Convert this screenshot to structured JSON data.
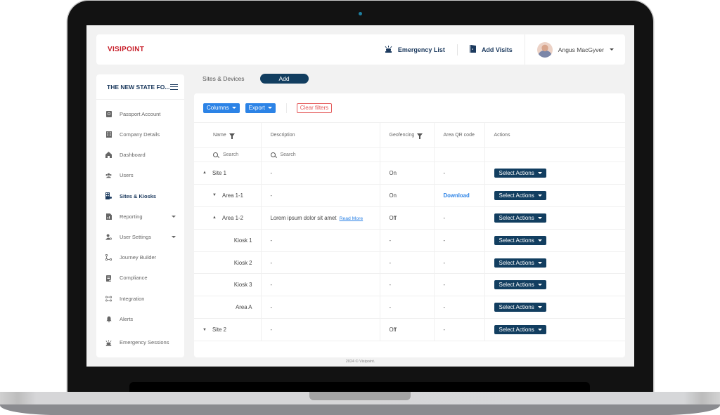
{
  "brand": {
    "logo": "VISIPOINT",
    "accent": "#c8202b",
    "primary": "#123e60",
    "link": "#2c83e6"
  },
  "header": {
    "emergency_list": "Emergency List",
    "add_visits": "Add Visits",
    "user_name": "Angus MacGyver"
  },
  "sidebar": {
    "org_name": "THE NEW STATE FO...",
    "items": [
      {
        "label": "Passport Account",
        "icon": "passport-icon"
      },
      {
        "label": "Company Details",
        "icon": "building-icon"
      },
      {
        "label": "Dashboard",
        "icon": "home-icon"
      },
      {
        "label": "Users",
        "icon": "users-icon"
      },
      {
        "label": "Sites & Kiosks",
        "icon": "sites-icon",
        "active": true
      },
      {
        "label": "Reporting",
        "icon": "report-icon",
        "expandable": true
      },
      {
        "label": "User Settings",
        "icon": "user-settings-icon",
        "expandable": true
      },
      {
        "label": "Journey Builder",
        "icon": "journey-icon"
      },
      {
        "label": "Compliance",
        "icon": "compliance-icon"
      },
      {
        "label": "Integration",
        "icon": "integration-icon"
      },
      {
        "label": "Alerts",
        "icon": "bell-icon"
      },
      {
        "label": "Emergency Sessions",
        "icon": "siren-icon"
      }
    ]
  },
  "content": {
    "breadcrumb": "Sites & Devices",
    "add_label": "Add",
    "toolbar": {
      "columns": "Columns",
      "export": "Export",
      "clear_filters": "Clear filters"
    },
    "table": {
      "columns": [
        "Name",
        "Description",
        "Geofencing",
        "Area QR code",
        "Actions"
      ],
      "search_placeholder": "Search",
      "rows": [
        {
          "name": "Site 1",
          "level": 0,
          "toggle": "up",
          "description": "-",
          "geofencing": "On",
          "qr": "-",
          "action": "Select Actions"
        },
        {
          "name": "Area 1-1",
          "level": 1,
          "toggle": "down",
          "description": "-",
          "geofencing": "On",
          "qr": "Download",
          "action": "Select Actions"
        },
        {
          "name": "Area 1-2",
          "level": 1,
          "toggle": "up",
          "description": "Lorem ipsum dolor sit amet",
          "read_more": "Read More",
          "geofencing": "Off",
          "qr": "-",
          "action": "Select Actions"
        },
        {
          "name": "Kiosk 1",
          "level": 2,
          "description": "-",
          "geofencing": "-",
          "qr": "-",
          "action": "Select Actions"
        },
        {
          "name": "Kiosk 2",
          "level": 2,
          "description": "-",
          "geofencing": "-",
          "qr": "-",
          "action": "Select Actions"
        },
        {
          "name": "Kiosk 3",
          "level": 2,
          "description": "-",
          "geofencing": "-",
          "qr": "-",
          "action": "Select Actions"
        },
        {
          "name": "Area A",
          "level": 2,
          "description": "-",
          "geofencing": "-",
          "qr": "-",
          "action": "Select Actions"
        },
        {
          "name": "Site 2",
          "level": 0,
          "toggle": "down",
          "description": "-",
          "geofencing": "Off",
          "qr": "-",
          "action": "Select Actions"
        }
      ]
    }
  },
  "footer": "2024 © Visipoint."
}
